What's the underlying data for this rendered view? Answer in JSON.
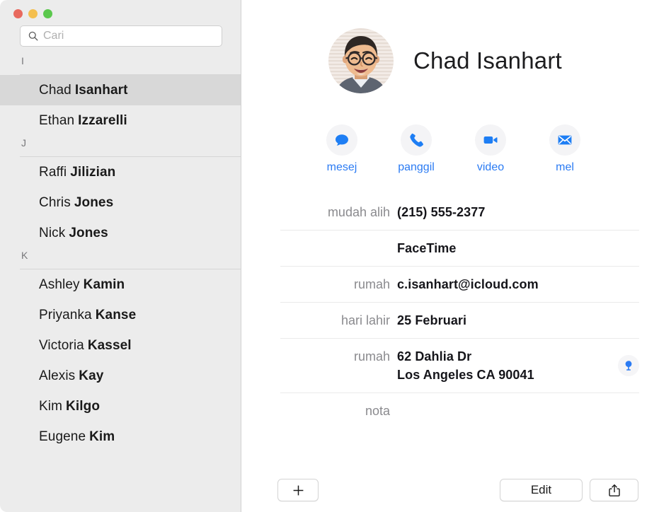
{
  "window": {
    "traffic_lights": [
      {
        "name": "close",
        "color": "#e8695e"
      },
      {
        "name": "minimize",
        "color": "#f4bf4f"
      },
      {
        "name": "zoom",
        "color": "#5bc84d"
      }
    ]
  },
  "search": {
    "placeholder": "Cari",
    "value": "",
    "icon": "search-icon"
  },
  "sidebar": {
    "sections": [
      {
        "letter": "I",
        "contacts": [
          {
            "first": "Chad",
            "last": "Isanhart",
            "selected": true
          },
          {
            "first": "Ethan",
            "last": "Izzarelli",
            "selected": false
          }
        ]
      },
      {
        "letter": "J",
        "contacts": [
          {
            "first": "Raffi",
            "last": "Jilizian",
            "selected": false
          },
          {
            "first": "Chris",
            "last": "Jones",
            "selected": false
          },
          {
            "first": "Nick",
            "last": "Jones",
            "selected": false
          }
        ]
      },
      {
        "letter": "K",
        "contacts": [
          {
            "first": "Ashley",
            "last": "Kamin",
            "selected": false
          },
          {
            "first": "Priyanka",
            "last": "Kanse",
            "selected": false
          },
          {
            "first": "Victoria",
            "last": "Kassel",
            "selected": false
          },
          {
            "first": "Alexis",
            "last": "Kay",
            "selected": false
          },
          {
            "first": "Kim",
            "last": "Kilgo",
            "selected": false
          },
          {
            "first": "Eugene",
            "last": "Kim",
            "selected": false
          }
        ]
      }
    ]
  },
  "detail": {
    "name": "Chad Isanhart",
    "avatar_alt": "contact-photo",
    "accent_color": "#2b7bf3",
    "actions": [
      {
        "label": "mesej",
        "icon": "message-icon"
      },
      {
        "label": "panggil",
        "icon": "phone-icon"
      },
      {
        "label": "video",
        "icon": "video-camera-icon"
      },
      {
        "label": "mel",
        "icon": "envelope-icon"
      }
    ],
    "fields": [
      {
        "label": "mudah alih",
        "value": "(215) 555-2377",
        "value2": "",
        "has_map_pin": false
      },
      {
        "label": "",
        "value": "FaceTime",
        "value2": "",
        "has_map_pin": false
      },
      {
        "label": "rumah",
        "value": "c.isanhart@icloud.com",
        "value2": "",
        "has_map_pin": false
      },
      {
        "label": "hari lahir",
        "value": "25 Februari",
        "value2": "",
        "has_map_pin": false
      },
      {
        "label": "rumah",
        "value": "62 Dahlia Dr",
        "value2": "Los Angeles CA 90041",
        "has_map_pin": true
      },
      {
        "label": "nota",
        "value": "",
        "value2": "",
        "has_map_pin": false
      }
    ]
  },
  "toolbar": {
    "add_label": "+",
    "edit_label": "Edit",
    "share_icon": "share-icon"
  }
}
